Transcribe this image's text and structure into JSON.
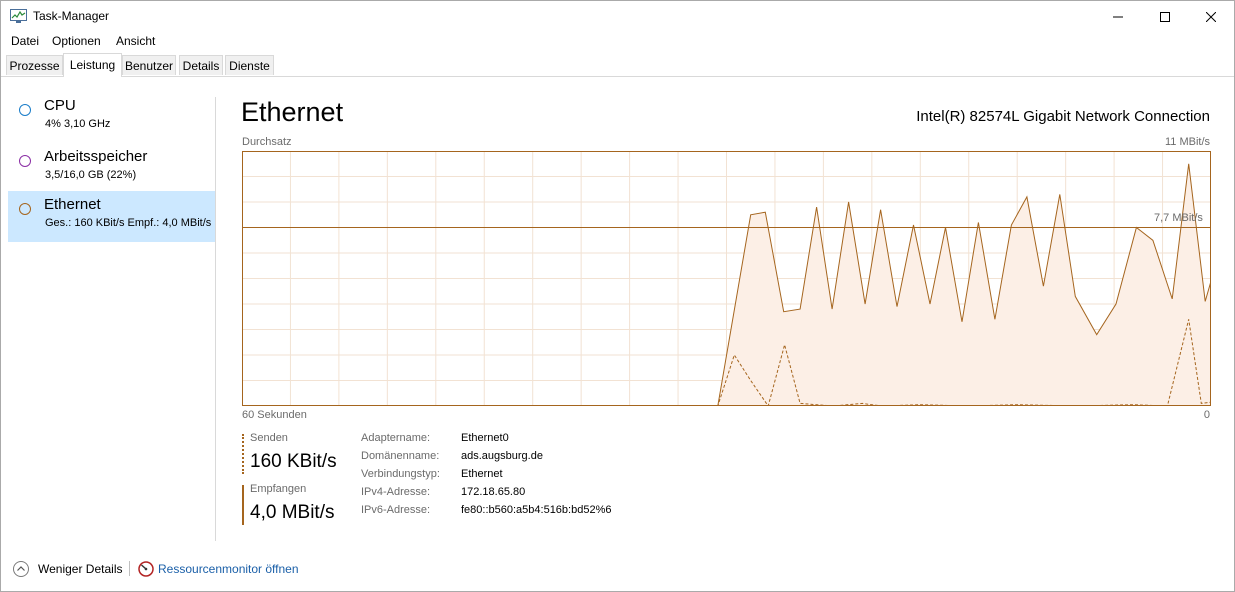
{
  "window": {
    "title": "Task-Manager"
  },
  "menu": [
    "Datei",
    "Optionen",
    "Ansicht"
  ],
  "tabs": [
    "Prozesse",
    "Leistung",
    "Benutzer",
    "Details",
    "Dienste"
  ],
  "active_tab": "Leistung",
  "sidebar": {
    "items": [
      {
        "title": "CPU",
        "sub": "4%  3,10 GHz",
        "color": "#1a7dc9"
      },
      {
        "title": "Arbeitsspeicher",
        "sub": "3,5/16,0 GB (22%)",
        "color": "#8b2fa5"
      },
      {
        "title": "Ethernet",
        "sub": "Ges.: 160 KBit/s Empf.: 4,0 MBit/s",
        "color": "#a5651e"
      }
    ],
    "selected": "Ethernet"
  },
  "main": {
    "title": "Ethernet",
    "adapter": "Intel(R) 82574L Gigabit Network Connection",
    "graph_label": "Durchsatz",
    "graph_max": "11 MBit/s",
    "graph_ref": "7,7 MBit/s",
    "graph_time_left": "60 Sekunden",
    "graph_time_right": "0",
    "line_color": "#a5651e",
    "fill_color": "#fcefe6"
  },
  "stats": {
    "send_label": "Senden",
    "send_value": "160 KBit/s",
    "recv_label": "Empfangen",
    "recv_value": "4,0 MBit/s"
  },
  "info": [
    {
      "key": "Adaptername:",
      "value": "Ethernet0"
    },
    {
      "key": "Domänenname:",
      "value": "ads.augsburg.de"
    },
    {
      "key": "Verbindungstyp:",
      "value": "Ethernet"
    },
    {
      "key": "IPv4-Adresse:",
      "value": "172.18.65.80"
    },
    {
      "key": "IPv6-Adresse:",
      "value": "fe80::b560:a5b4:516b:bd52%6"
    }
  ],
  "footer": {
    "less_details": "Weniger Details",
    "resource_monitor": "Ressourcenmonitor öffnen"
  }
}
